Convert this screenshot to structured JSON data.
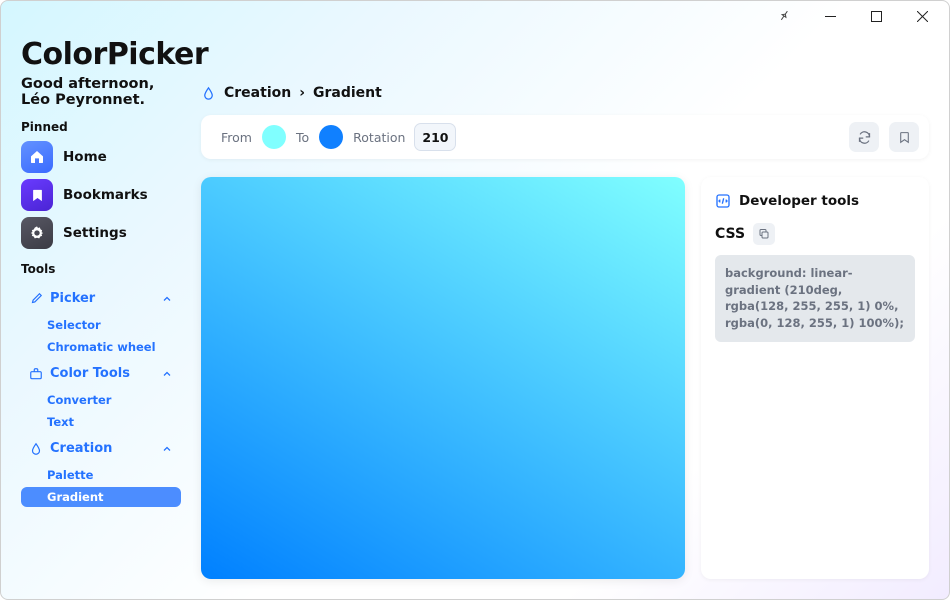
{
  "app": {
    "title": "ColorPicker",
    "greeting": "Good afternoon, Léo Peyronnet."
  },
  "sidebar": {
    "pinned_label": "Pinned",
    "tools_label": "Tools",
    "pinned": [
      {
        "label": "Home"
      },
      {
        "label": "Bookmarks"
      },
      {
        "label": "Settings"
      }
    ],
    "groups": {
      "picker": {
        "label": "Picker",
        "items": [
          {
            "label": "Selector"
          },
          {
            "label": "Chromatic wheel"
          }
        ]
      },
      "color_tools": {
        "label": "Color Tools",
        "items": [
          {
            "label": "Converter"
          },
          {
            "label": "Text"
          }
        ]
      },
      "creation": {
        "label": "Creation",
        "items": [
          {
            "label": "Palette"
          },
          {
            "label": "Gradient"
          }
        ]
      }
    }
  },
  "breadcrumb": {
    "category": "Creation",
    "page": "Gradient"
  },
  "controls": {
    "from_label": "From",
    "to_label": "To",
    "rotation_label": "Rotation",
    "rotation_value": "210",
    "from_color": "#80ffff",
    "to_color": "#1080ff"
  },
  "gradient": {
    "css_background": "linear-gradient(210deg, rgba(128, 255, 255, 1) 0%, rgba(0, 128, 255, 1) 100%)"
  },
  "dev": {
    "title": "Developer tools",
    "css_label": "CSS",
    "code": "background: linear-gradient (210deg, rgba(128, 255, 255, 1) 0%, rgba(0, 128, 255, 1) 100%);"
  }
}
